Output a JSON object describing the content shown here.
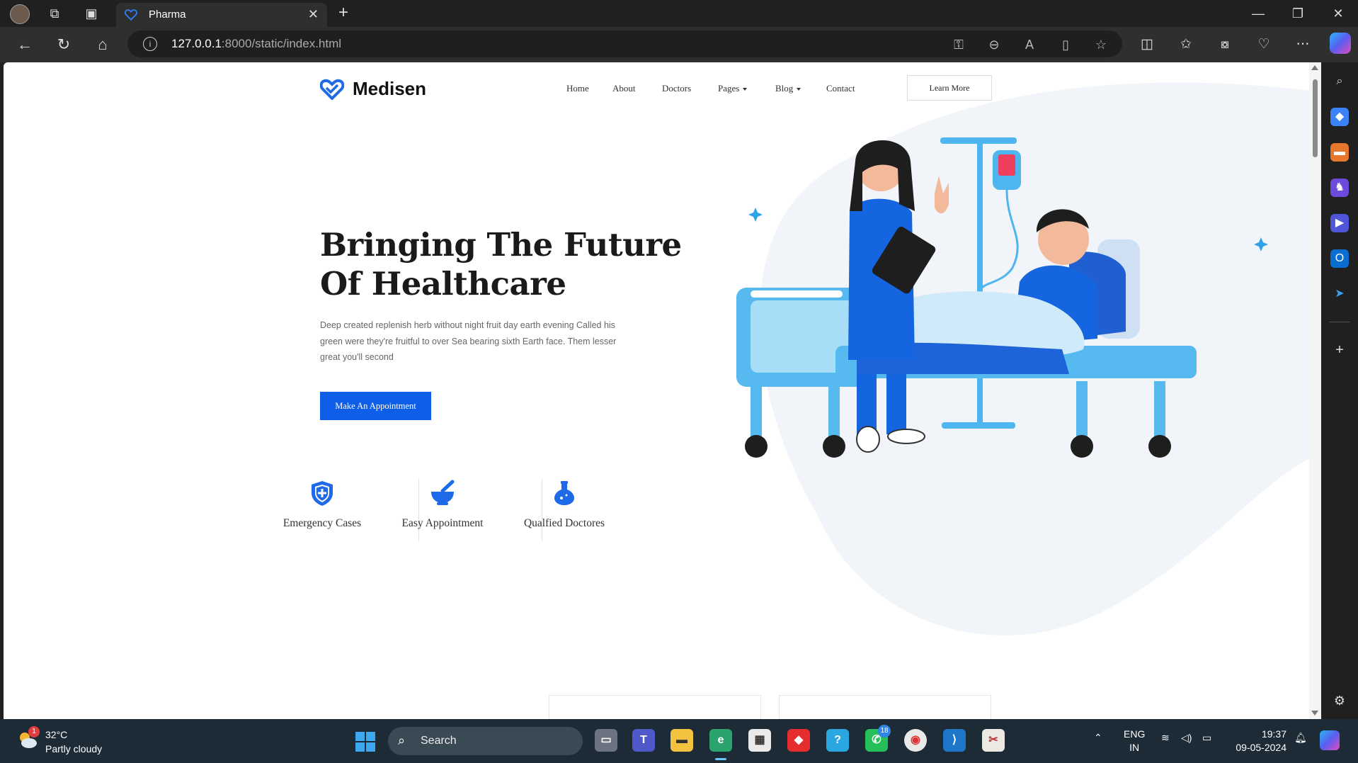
{
  "browser": {
    "tab_title": "Pharma",
    "url_host": "127.0.0.1",
    "url_path": ":8000/static/index.html"
  },
  "site": {
    "brand": "Medisen",
    "nav": [
      "Home",
      "About",
      "Doctors",
      "Pages",
      "Blog",
      "Contact"
    ],
    "learn_more": "Learn More",
    "hero": {
      "title_line1": "Bringing The Future",
      "title_line2": "Of Healthcare",
      "text": "Deep created replenish herb without night fruit day earth evening Called his green were they're fruitful to over Sea bearing sixth Earth face. Them lesser great you'll second",
      "cta": "Make An Appointment"
    },
    "features": [
      {
        "icon": "shield-plus-icon",
        "label": "Emergency Cases"
      },
      {
        "icon": "mortar-pestle-icon",
        "label": "Easy Appointment"
      },
      {
        "icon": "flask-icon",
        "label": "Qualfied Doctores"
      }
    ],
    "accent_color": "#0e5ee8"
  },
  "taskbar": {
    "weather_temp": "32°C",
    "weather_desc": "Partly cloudy",
    "weather_badge": "1",
    "search_label": "Search",
    "whatsapp_badge": "18",
    "lang_line1": "ENG",
    "lang_line2": "IN",
    "time": "19:37",
    "date": "09-05-2024"
  }
}
